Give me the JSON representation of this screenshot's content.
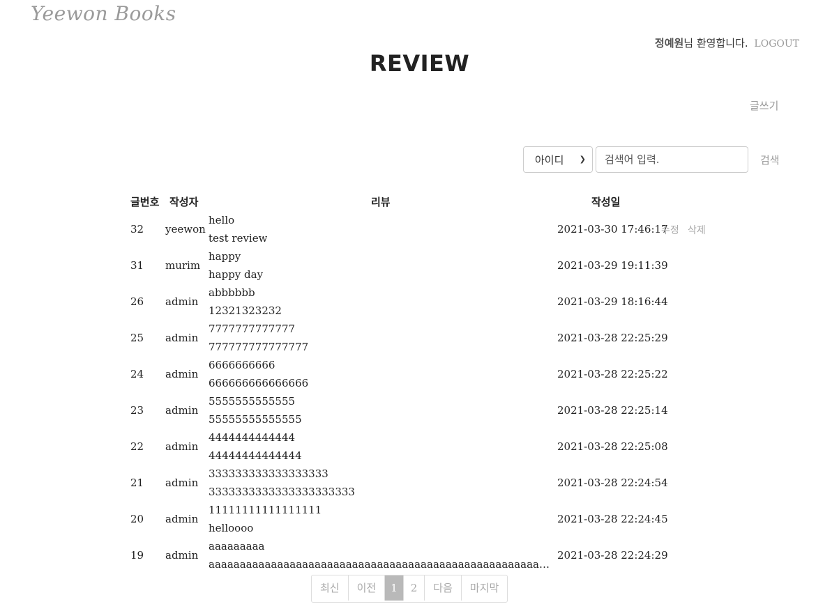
{
  "header": {
    "logo": "Yeewon Books",
    "user_name": "정예원",
    "welcome_suffix": "님 환영합니다.",
    "logout_label": "LOGOUT"
  },
  "page_title": "REVIEW",
  "write_label": "글쓰기",
  "search": {
    "field_selected": "아이디",
    "placeholder": "검색어 입력.",
    "button_label": "검색"
  },
  "table": {
    "headers": {
      "num": "글번호",
      "writer": "작성자",
      "review": "리뷰",
      "date": "작성일"
    },
    "rows": [
      {
        "num": "32",
        "writer": "yeewon",
        "title": "hello",
        "content": "test review",
        "date": "2021-03-30 17:46:17",
        "edit": "수정",
        "delete": "삭제"
      },
      {
        "num": "31",
        "writer": "murim",
        "title": "happy",
        "content": "happy day",
        "date": "2021-03-29 19:11:39"
      },
      {
        "num": "26",
        "writer": "admin",
        "title": "abbbbbb",
        "content": "12321323232",
        "date": "2021-03-29 18:16:44"
      },
      {
        "num": "25",
        "writer": "admin",
        "title": "7777777777777",
        "content": "777777777777777",
        "date": "2021-03-28 22:25:29"
      },
      {
        "num": "24",
        "writer": "admin",
        "title": "6666666666",
        "content": "666666666666666",
        "date": "2021-03-28 22:25:22"
      },
      {
        "num": "23",
        "writer": "admin",
        "title": "5555555555555",
        "content": "55555555555555",
        "date": "2021-03-28 22:25:14"
      },
      {
        "num": "22",
        "writer": "admin",
        "title": "4444444444444",
        "content": "44444444444444",
        "date": "2021-03-28 22:25:08"
      },
      {
        "num": "21",
        "writer": "admin",
        "title": "333333333333333333",
        "content": "3333333333333333333333",
        "date": "2021-03-28 22:24:54"
      },
      {
        "num": "20",
        "writer": "admin",
        "title": "11111111111111111",
        "content": "helloooo",
        "date": "2021-03-28 22:24:45"
      },
      {
        "num": "19",
        "writer": "admin",
        "title": "aaaaaaaaa",
        "content": "aaaaaaaaaaaaaaaaaaaaaaaaaaaaaaaaaaaaaaaaaaaaaaaaaaaaaaaaaaaaaaaaaaaaaaaa...",
        "date": "2021-03-28 22:24:29"
      }
    ]
  },
  "pagination": {
    "first": "최신",
    "prev": "이전",
    "pages": [
      "1",
      "2"
    ],
    "current": "1",
    "next": "다음",
    "last": "마지막"
  }
}
